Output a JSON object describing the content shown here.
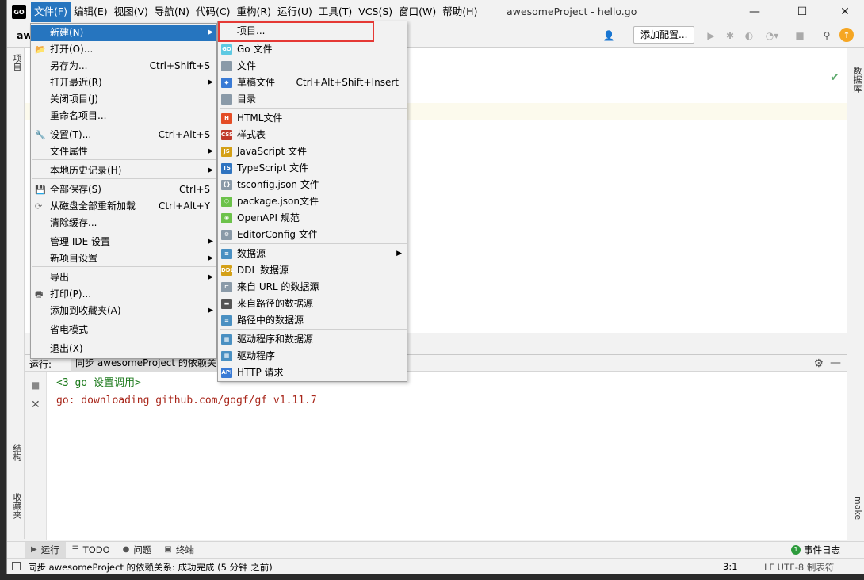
{
  "app": {
    "logo": "GO",
    "title": "awesomeProject - hello.go",
    "breadcrumb": "aw"
  },
  "menubar": [
    "文件(F)",
    "编辑(E)",
    "视图(V)",
    "导航(N)",
    "代码(C)",
    "重构(R)",
    "运行(U)",
    "工具(T)",
    "VCS(S)",
    "窗口(W)",
    "帮助(H)"
  ],
  "window_controls": {
    "minimize": "—",
    "maximize": "☐",
    "close": "✕"
  },
  "toolbar": {
    "config_label": "添加配置..."
  },
  "left_strip": {
    "project": "项目",
    "structure": "结构",
    "favorites": "收藏夹"
  },
  "right_strip": {
    "database": "数据库",
    "make": "make"
  },
  "file_menu": [
    {
      "label": "新建(N)",
      "shortcut": "",
      "submenu": true
    },
    {
      "label": "打开(O)...",
      "shortcut": "",
      "submenu": false
    },
    {
      "label": "另存为...",
      "shortcut": "Ctrl+Shift+S",
      "submenu": false
    },
    {
      "label": "打开最近(R)",
      "shortcut": "",
      "submenu": true
    },
    {
      "label": "关闭项目(J)",
      "shortcut": "",
      "submenu": false
    },
    {
      "label": "重命名项目...",
      "shortcut": "",
      "submenu": false
    },
    {
      "label": "设置(T)...",
      "shortcut": "Ctrl+Alt+S",
      "submenu": false
    },
    {
      "label": "文件属性",
      "shortcut": "",
      "submenu": true
    },
    {
      "label": "本地历史记录(H)",
      "shortcut": "",
      "submenu": true
    },
    {
      "label": "全部保存(S)",
      "shortcut": "Ctrl+S",
      "submenu": false
    },
    {
      "label": "从磁盘全部重新加载",
      "shortcut": "Ctrl+Alt+Y",
      "submenu": false
    },
    {
      "label": "清除缓存...",
      "shortcut": "",
      "submenu": false
    },
    {
      "label": "管理 IDE 设置",
      "shortcut": "",
      "submenu": true
    },
    {
      "label": "新项目设置",
      "shortcut": "",
      "submenu": true
    },
    {
      "label": "导出",
      "shortcut": "",
      "submenu": true
    },
    {
      "label": "打印(P)...",
      "shortcut": "",
      "submenu": false
    },
    {
      "label": "添加到收藏夹(A)",
      "shortcut": "",
      "submenu": true
    },
    {
      "label": "省电模式",
      "shortcut": "",
      "submenu": false
    },
    {
      "label": "退出(X)",
      "shortcut": "",
      "submenu": false
    }
  ],
  "new_menu": [
    {
      "label": "项目...",
      "icon": "",
      "shortcut": "",
      "submenu": false
    },
    {
      "label": "Go 文件",
      "icon": "go",
      "shortcut": "",
      "submenu": false
    },
    {
      "label": "文件",
      "icon": "file",
      "shortcut": "",
      "submenu": false
    },
    {
      "label": "草稿文件",
      "icon": "scratch",
      "shortcut": "Ctrl+Alt+Shift+Insert",
      "submenu": false
    },
    {
      "label": "目录",
      "icon": "folder",
      "shortcut": "",
      "submenu": false
    },
    {
      "label": "HTML文件",
      "icon": "html",
      "shortcut": "",
      "submenu": false
    },
    {
      "label": "样式表",
      "icon": "css",
      "shortcut": "",
      "submenu": false
    },
    {
      "label": "JavaScript 文件",
      "icon": "js",
      "shortcut": "",
      "submenu": false
    },
    {
      "label": "TypeScript 文件",
      "icon": "ts",
      "shortcut": "",
      "submenu": false
    },
    {
      "label": "tsconfig.json 文件",
      "icon": "json",
      "shortcut": "",
      "submenu": false
    },
    {
      "label": "package.json文件",
      "icon": "node",
      "shortcut": "",
      "submenu": false
    },
    {
      "label": "OpenAPI 规范",
      "icon": "openapi",
      "shortcut": "",
      "submenu": false
    },
    {
      "label": "EditorConfig 文件",
      "icon": "editorconfig",
      "shortcut": "",
      "submenu": false
    },
    {
      "label": "数据源",
      "icon": "db",
      "shortcut": "",
      "submenu": true
    },
    {
      "label": "DDL 数据源",
      "icon": "ddl",
      "shortcut": "",
      "submenu": false
    },
    {
      "label": "来自 URL 的数据源",
      "icon": "url",
      "shortcut": "",
      "submenu": false
    },
    {
      "label": "来自路径的数据源",
      "icon": "path",
      "shortcut": "",
      "submenu": false
    },
    {
      "label": "路径中的数据源",
      "icon": "db",
      "shortcut": "",
      "submenu": false
    },
    {
      "label": "驱动程序和数据源",
      "icon": "driver",
      "shortcut": "",
      "submenu": false
    },
    {
      "label": "驱动程序",
      "icon": "driver",
      "shortcut": "",
      "submenu": false
    },
    {
      "label": "HTTP 请求",
      "icon": "api",
      "shortcut": "",
      "submenu": false
    }
  ],
  "run_panel": {
    "label": "运行:",
    "tab": "同步 awesomeProject 的依赖关",
    "lines": [
      "<3 go 设置调用>",
      "go: downloading github.com/gogf/gf v1.11.7"
    ]
  },
  "bottom_tools": [
    {
      "label": "运行",
      "icon": "▶"
    },
    {
      "label": "TODO",
      "icon": "☰"
    },
    {
      "label": "问题",
      "icon": "●"
    },
    {
      "label": "终端",
      "icon": "▣"
    }
  ],
  "event_log": "事件日志",
  "status": {
    "message": "同步 awesomeProject 的依赖关系: 成功完成 (5 分钟 之前)",
    "position": "3:1",
    "encoding": "LF  UTF-8  制表符"
  },
  "colors": {
    "accent": "#2675bf",
    "highlight_box": "#e53935",
    "console_green": "#1c7a1c",
    "console_red": "#a8261a"
  }
}
